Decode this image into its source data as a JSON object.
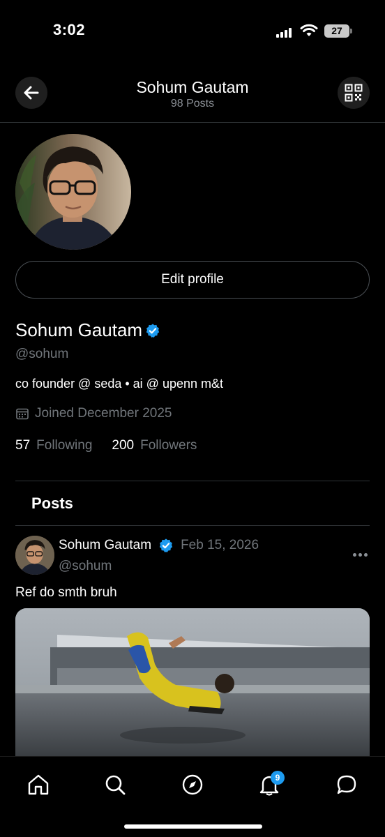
{
  "status_bar": {
    "time": "3:02",
    "battery": "27"
  },
  "header": {
    "title": "Sohum Gautam",
    "subtitle": "98 Posts",
    "back_icon": "arrow-left-icon",
    "qr_icon": "qr-code-icon"
  },
  "profile": {
    "edit_label": "Edit profile",
    "name": "Sohum Gautam",
    "handle": "@sohum",
    "bio": "co founder @ seda • ai @ upenn m&t",
    "joined": "Joined December 2025",
    "following_count": "57",
    "following_label": "Following",
    "followers_count": "200",
    "followers_label": "Followers"
  },
  "tabs": {
    "posts_label": "Posts"
  },
  "post": {
    "author": "Sohum Gautam",
    "date": "Feb 15, 2026",
    "handle": "@sohum",
    "text": "Ref do smth bruh"
  },
  "nav": {
    "items": [
      "home-icon",
      "search-icon",
      "compass-icon",
      "bell-icon",
      "chat-icon"
    ],
    "notification_badge": "9"
  },
  "colors": {
    "background": "#000000",
    "accent": "#1d9bf0",
    "secondary_text": "#71767b",
    "divider": "#2f3336"
  }
}
